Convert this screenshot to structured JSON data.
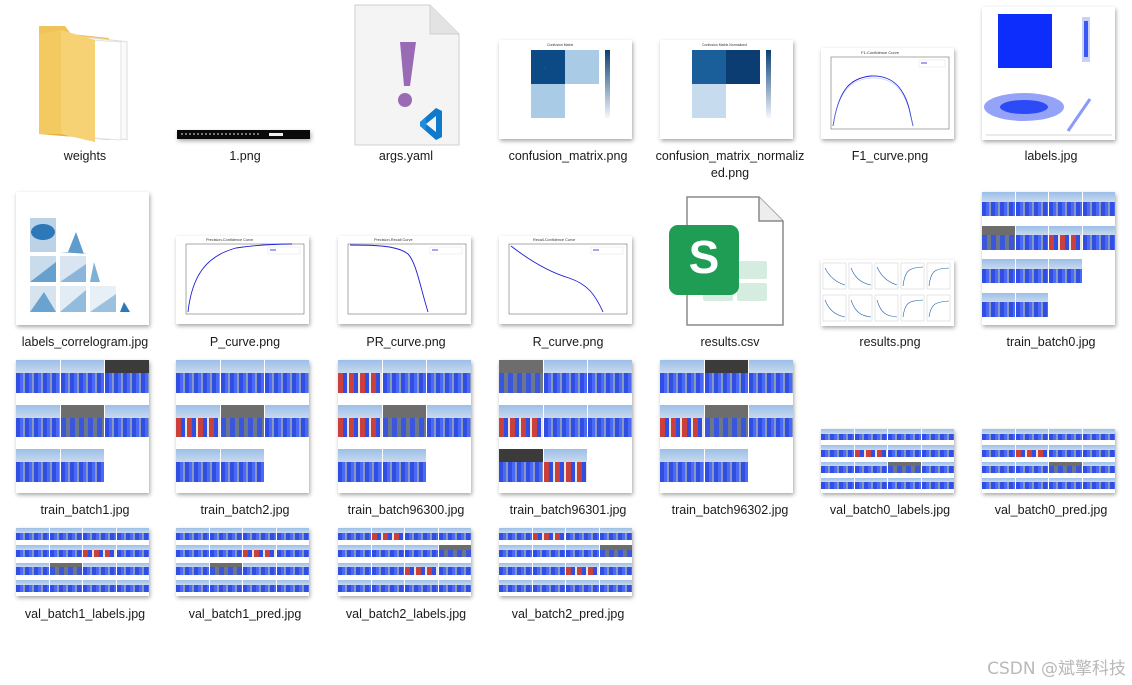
{
  "files": [
    {
      "name": "weights"
    },
    {
      "name": "1.png"
    },
    {
      "name": "args.yaml"
    },
    {
      "name": "confusion_matrix.png"
    },
    {
      "name": "confusion_matrix_normalized.png"
    },
    {
      "name": "F1_curve.png"
    },
    {
      "name": "labels.jpg"
    },
    {
      "name": "labels_correlogram.jpg"
    },
    {
      "name": "P_curve.png"
    },
    {
      "name": "PR_curve.png"
    },
    {
      "name": "R_curve.png"
    },
    {
      "name": "results.csv"
    },
    {
      "name": "results.png"
    },
    {
      "name": "train_batch0.jpg"
    },
    {
      "name": "train_batch1.jpg"
    },
    {
      "name": "train_batch2.jpg"
    },
    {
      "name": "train_batch96300.jpg"
    },
    {
      "name": "train_batch96301.jpg"
    },
    {
      "name": "train_batch96302.jpg"
    },
    {
      "name": "val_batch0_labels.jpg"
    },
    {
      "name": "val_batch0_pred.jpg"
    },
    {
      "name": "val_batch1_labels.jpg"
    },
    {
      "name": "val_batch1_pred.jpg"
    },
    {
      "name": "val_batch2_labels.jpg"
    },
    {
      "name": "val_batch2_pred.jpg"
    }
  ],
  "thumbnail_text": {
    "confusion_title": "Confusion Matrix",
    "confusion_norm_title": "Confusion Matrix Normalized",
    "f1_title": "F1-Confidence Curve",
    "p_title": "Precision-Confidence Curve",
    "pr_title": "Precision-Recall Curve",
    "r_title": "Recall-Confidence Curve",
    "results_csv_letter": "S",
    "args_glyph": "!"
  },
  "watermark": "CSDN @斌擎科技",
  "colors": {
    "folder": "#f5c85c",
    "curve_blue": "#1f1fd6",
    "matrix_dark": "#0b4a84",
    "matrix_light": "#a9cbe5",
    "csv_green": "#1f9d55",
    "vscode_blue": "#0f7acc",
    "yaml_purple": "#9a6bb5",
    "bbox_blue": "#1e3fe0"
  }
}
